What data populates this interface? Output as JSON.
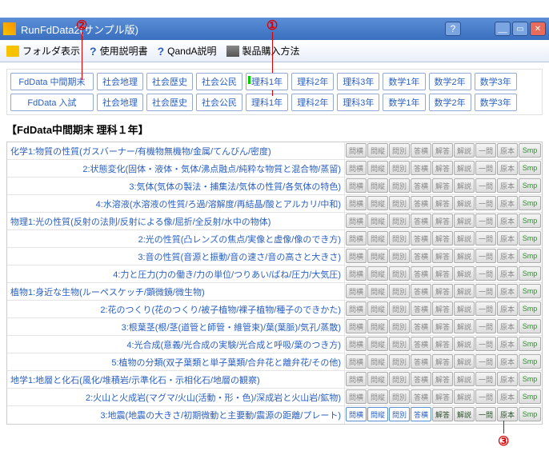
{
  "annotations": {
    "a1": "①",
    "a2": "②",
    "a3": "③"
  },
  "titlebar": {
    "title": "RunFdData2(サンプル版)"
  },
  "toolbar": {
    "folder": "フォルダ表示",
    "manual": "使用説明書",
    "qanda": "QandA説明",
    "purchase": "製品購入方法"
  },
  "subjects": {
    "row1_lead": "FdData 中間期末",
    "row2_lead": "FdData 入試",
    "cols": [
      "社会地理",
      "社会歴史",
      "社会公民",
      "理科1年",
      "理科2年",
      "理科3年",
      "数学1年",
      "数学2年",
      "数学3年"
    ]
  },
  "section_title": "【FdData中間期末 理科１年】",
  "mini_labels": [
    "問横",
    "問縦",
    "問別",
    "答横",
    "解答",
    "解説",
    "一問",
    "原本",
    "Smp"
  ],
  "rows": [
    "化学1:物質の性質(ガスバーナー/有機物無機物/金属/てんびん/密度)",
    "2:状態変化(固体・液体・気体/沸点融点/純粋な物質と混合物/蒸留)",
    "3:気体(気体の製法・捕集法/気体の性質/各気体の特色)",
    "4:水溶液(水溶液の性質/ろ過/溶解度/再結晶/酸とアルカリ/中和)",
    "物理1:光の性質(反射の法則/反射による像/屈折/全反射/水中の物体)",
    "2:光の性質(凸レンズの焦点/実像と虚像/像のでき方)",
    "3:音の性質(音源と振動/音の速さ/音の高さと大きさ)",
    "4:力と圧力(力の働き/力の単位/つりあい/ばね/圧力/大気圧)",
    "植物1:身近な生物(ルーペスケッチ/顕微鏡/微生物)",
    "2:花のつくり(花のつくり/被子植物/裸子植物/種子のできかた)",
    "3:根葉茎(根/茎(道管と師管・維管束)/葉(葉脈)/気孔/蒸散)",
    "4:光合成(意義/光合成の実験/光合成と呼吸/葉のつき方)",
    "5:植物の分類(双子葉類と単子葉類/合弁花と離弁花/その他)",
    "地学1:地層と化石(風化/堆積岩/示準化石・示相化石/地層の観察)",
    "2:火山と火成岩(マグマ/火山(活動・形・色)/深成岩と火山岩/鉱物)",
    "3:地震(地震の大きさ/初期微動と主要動/震源の距離/プレート)"
  ],
  "active_row_index": 15
}
